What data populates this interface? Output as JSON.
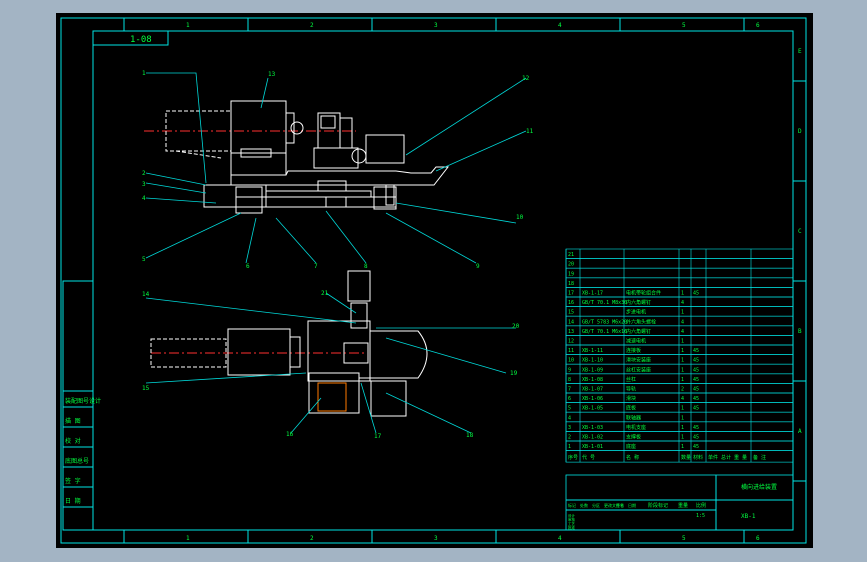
{
  "colors": {
    "background": "#000000",
    "frame": "#00e5e5",
    "part": "#ffffff",
    "centerline": "#ff3030",
    "leader": "#00d8d8",
    "text": "#00ff40"
  },
  "sheet": {
    "drawing_code_box": "1-08",
    "zone_columns_top": [
      "1",
      "2",
      "3",
      "4",
      "5",
      "6"
    ],
    "zone_columns_bottom": [
      "1",
      "2",
      "3",
      "4",
      "5",
      "6"
    ],
    "zone_rows_right": [
      "E",
      "D",
      "C",
      "B",
      "A"
    ]
  },
  "left_box_labels": [
    "装配图号设计",
    "描 图",
    "校 对",
    "底图总号",
    "签 字",
    "日 期"
  ],
  "balloons_top": [
    "1",
    "2",
    "3",
    "4",
    "5",
    "6",
    "7",
    "8",
    "9",
    "10",
    "11",
    "12",
    "13"
  ],
  "balloons_bottom": [
    "14",
    "15",
    "16",
    "17",
    "18",
    "19",
    "20",
    "21"
  ],
  "bom": {
    "rows": [
      {
        "no": "21",
        "code": "",
        "name": "",
        "qty": "",
        "mat": ""
      },
      {
        "no": "20",
        "code": "",
        "name": "",
        "qty": "",
        "mat": ""
      },
      {
        "no": "19",
        "code": "",
        "name": "",
        "qty": "",
        "mat": ""
      },
      {
        "no": "18",
        "code": "",
        "name": "",
        "qty": "",
        "mat": ""
      },
      {
        "no": "17",
        "code": "XB-1-17",
        "name": "电机带轮组合件",
        "qty": "1",
        "mat": "45"
      },
      {
        "no": "16",
        "code": "GB/T 70.1 M8x30",
        "name": "内六角螺钉",
        "qty": "4",
        "mat": ""
      },
      {
        "no": "15",
        "code": "",
        "name": "步进电机",
        "qty": "1",
        "mat": ""
      },
      {
        "no": "14",
        "code": "GB/T 5783 M6x20",
        "name": "外六角头螺栓",
        "qty": "4",
        "mat": ""
      },
      {
        "no": "13",
        "code": "GB/T 70.1 M6x16",
        "name": "内六角螺钉",
        "qty": "4",
        "mat": ""
      },
      {
        "no": "12",
        "code": "",
        "name": "减速电机",
        "qty": "1",
        "mat": ""
      },
      {
        "no": "11",
        "code": "XB-1-11",
        "name": "连接板",
        "qty": "1",
        "mat": "45"
      },
      {
        "no": "10",
        "code": "XB-1-10",
        "name": "滑块安装座",
        "qty": "1",
        "mat": "45"
      },
      {
        "no": "9",
        "code": "XB-1-09",
        "name": "丝杠安装座",
        "qty": "1",
        "mat": "45"
      },
      {
        "no": "8",
        "code": "XB-1-08",
        "name": "丝杠",
        "qty": "1",
        "mat": "45"
      },
      {
        "no": "7",
        "code": "XB-1-07",
        "name": "导轨",
        "qty": "2",
        "mat": "45"
      },
      {
        "no": "6",
        "code": "XB-1-06",
        "name": "滑块",
        "qty": "4",
        "mat": "45"
      },
      {
        "no": "5",
        "code": "XB-1-05",
        "name": "底板",
        "qty": "1",
        "mat": "45"
      },
      {
        "no": "4",
        "code": "",
        "name": "联轴器",
        "qty": "1",
        "mat": ""
      },
      {
        "no": "3",
        "code": "XB-1-03",
        "name": "电机支座",
        "qty": "1",
        "mat": "45"
      },
      {
        "no": "2",
        "code": "XB-1-02",
        "name": "支撑板",
        "qty": "1",
        "mat": "45"
      },
      {
        "no": "1",
        "code": "XB-1-01",
        "name": "底座",
        "qty": "1",
        "mat": "45"
      }
    ],
    "header": [
      "序号",
      "代 号",
      "名 称",
      "数量",
      "材料",
      "单件 总计 重 量",
      "备 注"
    ]
  },
  "title_block": {
    "title": "横向进给装置",
    "drawing_no": "XB-1",
    "scale_label": "比例",
    "scale": "1:5",
    "stage_label": "阶段标记",
    "weight_label": "重量",
    "sign_labels": [
      "标记",
      "处数",
      "分区",
      "更改文件号",
      "签名",
      "日期"
    ],
    "role_labels": [
      "设计",
      "审核",
      "工艺",
      "批准"
    ]
  }
}
